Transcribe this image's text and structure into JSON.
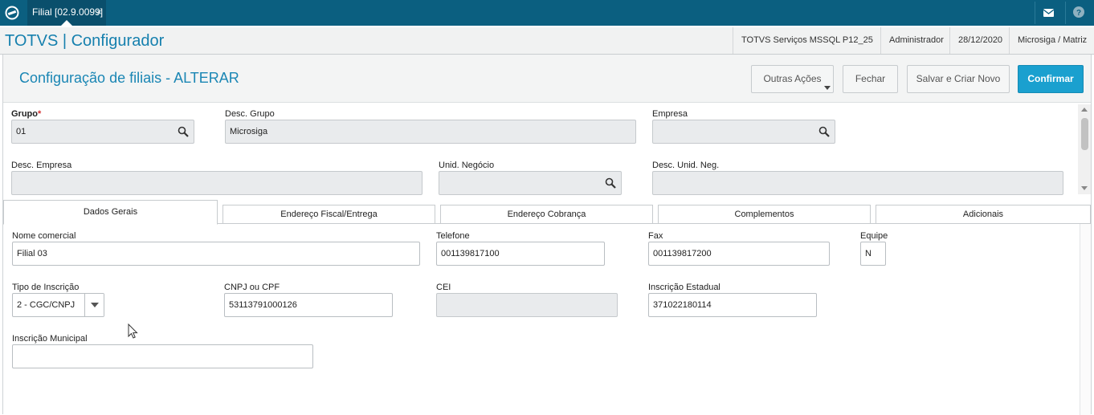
{
  "topbar": {
    "tab_label": "Filial [02.9.0099]",
    "tab_close": "×",
    "mail_icon": "mail-icon",
    "help_icon": "help-icon",
    "color": "#0b5f80"
  },
  "header": {
    "app_title": "TOTVS | Configurador",
    "environment": "TOTVS Serviços MSSQL P12_25",
    "user": "Administrador",
    "date": "28/12/2020",
    "branch": "Microsiga / Matriz"
  },
  "page": {
    "title": "Configuração de filiais - ALTERAR",
    "buttons": {
      "other_actions": "Outras Ações",
      "close": "Fechar",
      "save_new": "Salvar e Criar Novo",
      "confirm": "Confirmar"
    }
  },
  "form": {
    "grupo": {
      "label": "Grupo",
      "required": "*",
      "value": "01"
    },
    "desc_grupo": {
      "label": "Desc. Grupo",
      "value": "Microsiga"
    },
    "empresa": {
      "label": "Empresa",
      "value": ""
    },
    "desc_empresa": {
      "label": "Desc. Empresa",
      "value": ""
    },
    "unid_negocio": {
      "label": "Unid. Negócio",
      "value": ""
    },
    "desc_unid_neg": {
      "label": "Desc. Unid. Neg.",
      "value": ""
    }
  },
  "tabs": [
    {
      "label": "Dados Gerais",
      "active": true
    },
    {
      "label": "Endereço Fiscal/Entrega",
      "active": false
    },
    {
      "label": "Endereço Cobrança",
      "active": false
    },
    {
      "label": "Complementos",
      "active": false
    },
    {
      "label": "Adicionais",
      "active": false
    }
  ],
  "dados_gerais": {
    "nome_comercial": {
      "label": "Nome comercial",
      "value": "Filial 03"
    },
    "telefone": {
      "label": "Telefone",
      "value": "001139817100"
    },
    "fax": {
      "label": "Fax",
      "value": "001139817200"
    },
    "equipe": {
      "label": "Equipe",
      "value": "N"
    },
    "tipo_inscricao": {
      "label": "Tipo de Inscrição",
      "value": "2 - CGC/CNPJ"
    },
    "cnpj_cpf": {
      "label": "CNPJ ou CPF",
      "value": "53113791000126"
    },
    "cei": {
      "label": "CEI",
      "value": ""
    },
    "inscricao_estadual": {
      "label": "Inscrição Estadual",
      "value": "371022180114"
    },
    "inscricao_municipal": {
      "label": "Inscrição Municipal",
      "value": ""
    }
  }
}
